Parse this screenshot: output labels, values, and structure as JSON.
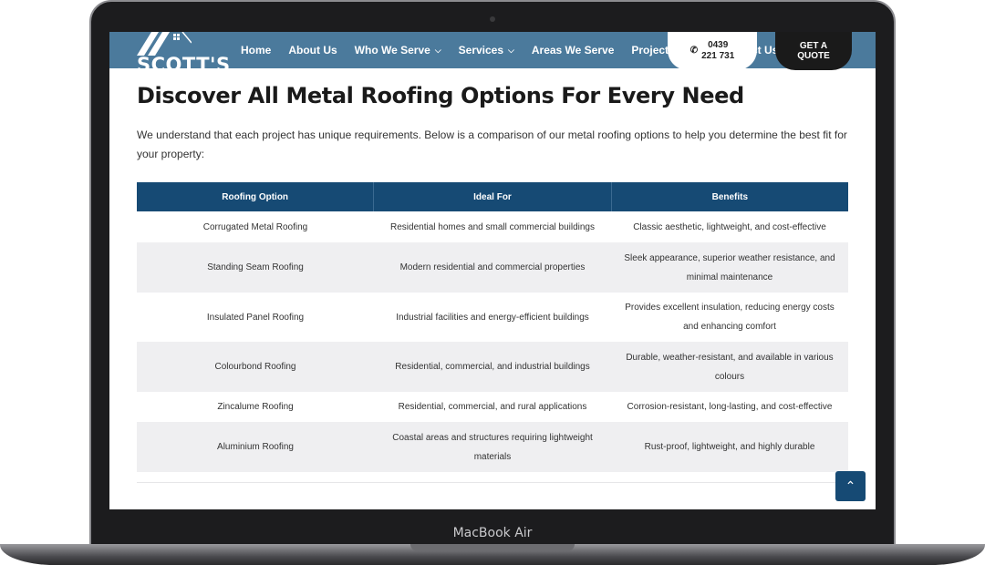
{
  "device": {
    "label": "MacBook Air"
  },
  "nav": {
    "logo_text": "SCOTT'S",
    "items": [
      {
        "label": "Home",
        "dropdown": false
      },
      {
        "label": "About Us",
        "dropdown": false
      },
      {
        "label": "Who We Serve",
        "dropdown": true
      },
      {
        "label": "Services",
        "dropdown": true
      },
      {
        "label": "Areas We Serve",
        "dropdown": false
      },
      {
        "label": "Projects",
        "dropdown": false
      }
    ],
    "contact_partial": "ct Us",
    "phone": {
      "line1": "0439",
      "line2": "221 731"
    },
    "quote": {
      "line1": "GET A",
      "line2": "QUOTE"
    }
  },
  "content": {
    "title": "Discover All Metal Roofing Options For Every Need",
    "intro": "We understand that each project has unique requirements. Below is a comparison of our metal roofing options to help you determine the best fit for your property:",
    "table": {
      "headers": [
        "Roofing Option",
        "Ideal For",
        "Benefits"
      ],
      "rows": [
        [
          "Corrugated Metal Roofing",
          "Residential homes and small commercial buildings",
          "Classic aesthetic, lightweight, and cost-effective"
        ],
        [
          "Standing Seam Roofing",
          "Modern residential and commercial properties",
          "Sleek appearance, superior weather resistance, and minimal maintenance"
        ],
        [
          "Insulated Panel Roofing",
          "Industrial facilities and energy-efficient buildings",
          "Provides excellent insulation, reducing energy costs and enhancing comfort"
        ],
        [
          "Colourbond Roofing",
          "Residential, commercial, and industrial buildings",
          "Durable, weather-resistant, and available in various colours"
        ],
        [
          "Zincalume Roofing",
          "Residential, commercial, and rural applications",
          "Corrosion-resistant, long-lasting, and cost-effective"
        ],
        [
          "Aluminium Roofing",
          "Coastal areas and structures requiring lightweight materials",
          "Rust-proof, lightweight, and highly durable"
        ]
      ]
    }
  },
  "colors": {
    "nav_bg": "#4b7a9c",
    "table_header": "#164a74",
    "quote_bg": "#1a1a1a"
  },
  "icons": {
    "phone": "phone-icon",
    "chevron": "chevron-down-icon",
    "scroll_top": "chevron-up-icon"
  }
}
